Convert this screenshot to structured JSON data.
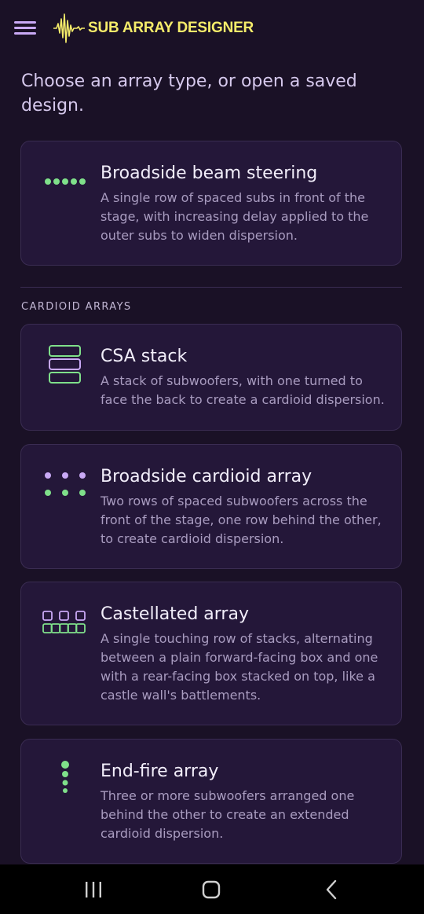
{
  "app": {
    "title": "SUB ARRAY DESIGNER"
  },
  "intro": "Choose an array type, or open a saved design.",
  "section_label": "CARDIOID ARRAYS",
  "cards": [
    {
      "title": "Broadside beam steering",
      "description": "A single row of spaced subs in front of the stage, with increasing delay applied to the outer subs to widen dispersion.",
      "icon": "broadside-icon"
    },
    {
      "title": "CSA stack",
      "description": "A stack of subwoofers, with one turned to face the back to create a cardioid dispersion.",
      "icon": "csa-stack-icon"
    },
    {
      "title": "Broadside cardioid array",
      "description": "Two rows of spaced subwoofers across the front of the stage, one row behind the other, to create cardioid dispersion.",
      "icon": "broadside-cardioid-icon"
    },
    {
      "title": "Castellated array",
      "description": "A single touching row of stacks, alternating between a plain forward-facing box and one with a rear-facing box stacked on top, like a castle wall's battlements.",
      "icon": "castellated-icon"
    },
    {
      "title": "End-fire array",
      "description": "Three or more subwoofers arranged one behind the other to create an extended cardioid dispersion.",
      "icon": "end-fire-icon"
    }
  ],
  "colors": {
    "background": "#1a1126",
    "card": "#241739",
    "green": "#7fe08a",
    "lavender": "#c9a9f5",
    "logo": "#f5ec6a"
  },
  "nav": {
    "icons": [
      "recent-apps-icon",
      "home-icon",
      "back-icon"
    ]
  }
}
